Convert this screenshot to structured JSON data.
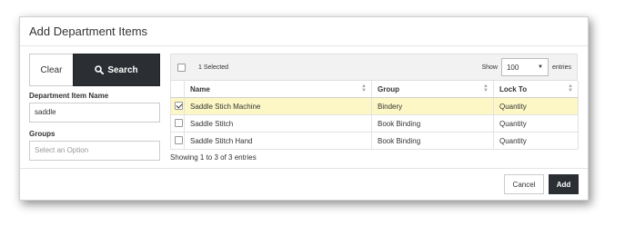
{
  "dialog": {
    "title": "Add Department Items"
  },
  "filters": {
    "clear_label": "Clear",
    "search_label": "Search",
    "item_name_label": "Department Item Name",
    "item_name_value": "saddle",
    "groups_label": "Groups",
    "groups_placeholder": "Select an Option"
  },
  "table": {
    "selected_count": "1 Selected",
    "show_label": "Show",
    "page_size": "100",
    "entries_label": "entries",
    "columns": [
      "Name",
      "Group",
      "Lock To"
    ],
    "rows": [
      {
        "checked": true,
        "name": "Saddle Stich Machine",
        "group": "Bindery",
        "lock_to": "Quantity"
      },
      {
        "checked": false,
        "name": "Saddle Stitch",
        "group": "Book Binding",
        "lock_to": "Quantity"
      },
      {
        "checked": false,
        "name": "Saddle Stitch Hand",
        "group": "Book Binding",
        "lock_to": "Quantity"
      }
    ],
    "info": "Showing 1 to 3 of 3 entries"
  },
  "footer": {
    "cancel_label": "Cancel",
    "add_label": "Add"
  },
  "colors": {
    "primary_dark": "#2b2f33",
    "selected_row": "#fcf7c5"
  }
}
